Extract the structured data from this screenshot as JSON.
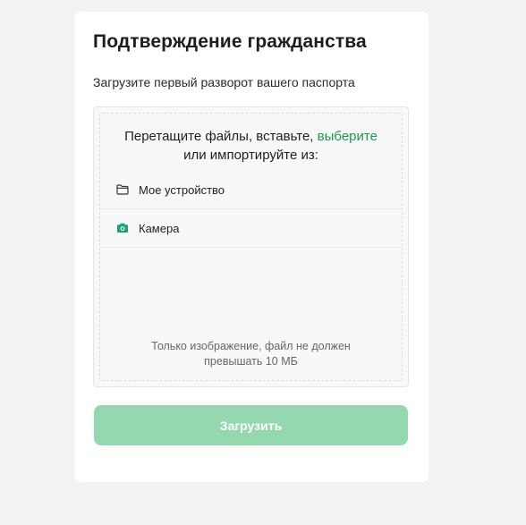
{
  "card": {
    "title": "Подтверждение гражданства",
    "subtitle": "Загрузите первый разворот вашего паспорта"
  },
  "dropzone": {
    "heading_prefix": "Перетащите файлы, вставьте, ",
    "browse_link": "выберите",
    "heading_line2": "или импортируйте из:",
    "sources": [
      {
        "label": "Мое устройство",
        "icon": "folder-icon"
      },
      {
        "label": "Камера",
        "icon": "camera-icon"
      }
    ],
    "note_line1": "Только изображение, файл не должен",
    "note_line2": "превышать 10 МБ"
  },
  "upload_button": {
    "label": "Загрузить"
  },
  "colors": {
    "accent": "#1c9a4d",
    "camera_icon": "#17a673",
    "button_bg": "#93d8af",
    "page_bg": "#f3f3f3"
  }
}
